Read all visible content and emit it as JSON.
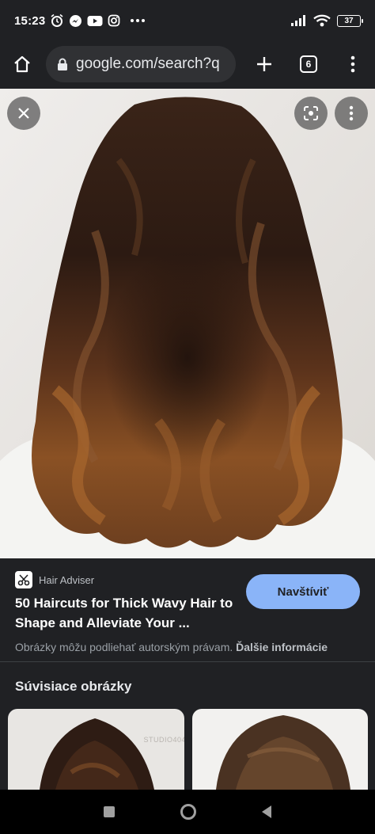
{
  "status_bar": {
    "time": "15:23",
    "battery": "37"
  },
  "toolbar": {
    "url": "google.com/search?q",
    "tab_count": "6"
  },
  "result": {
    "source": "Hair Adviser",
    "title": "50 Haircuts for Thick Wavy Hair to Shape and Alleviate Your ...",
    "visit_label": "Navštíviť",
    "copyright_text": "Obrázky môžu podliehať autorským právam.",
    "more_info_label": "Ďalšie informácie"
  },
  "related": {
    "heading": "Súvisiace obrázky",
    "watermark": "STUDIO404"
  },
  "colors": {
    "background": "#202124",
    "accent": "#8ab4f8"
  },
  "icons": [
    "home-icon",
    "lock-icon",
    "plus-icon",
    "tabs-icon",
    "more-vert-icon",
    "close-icon",
    "lens-icon",
    "scissors-icon"
  ]
}
